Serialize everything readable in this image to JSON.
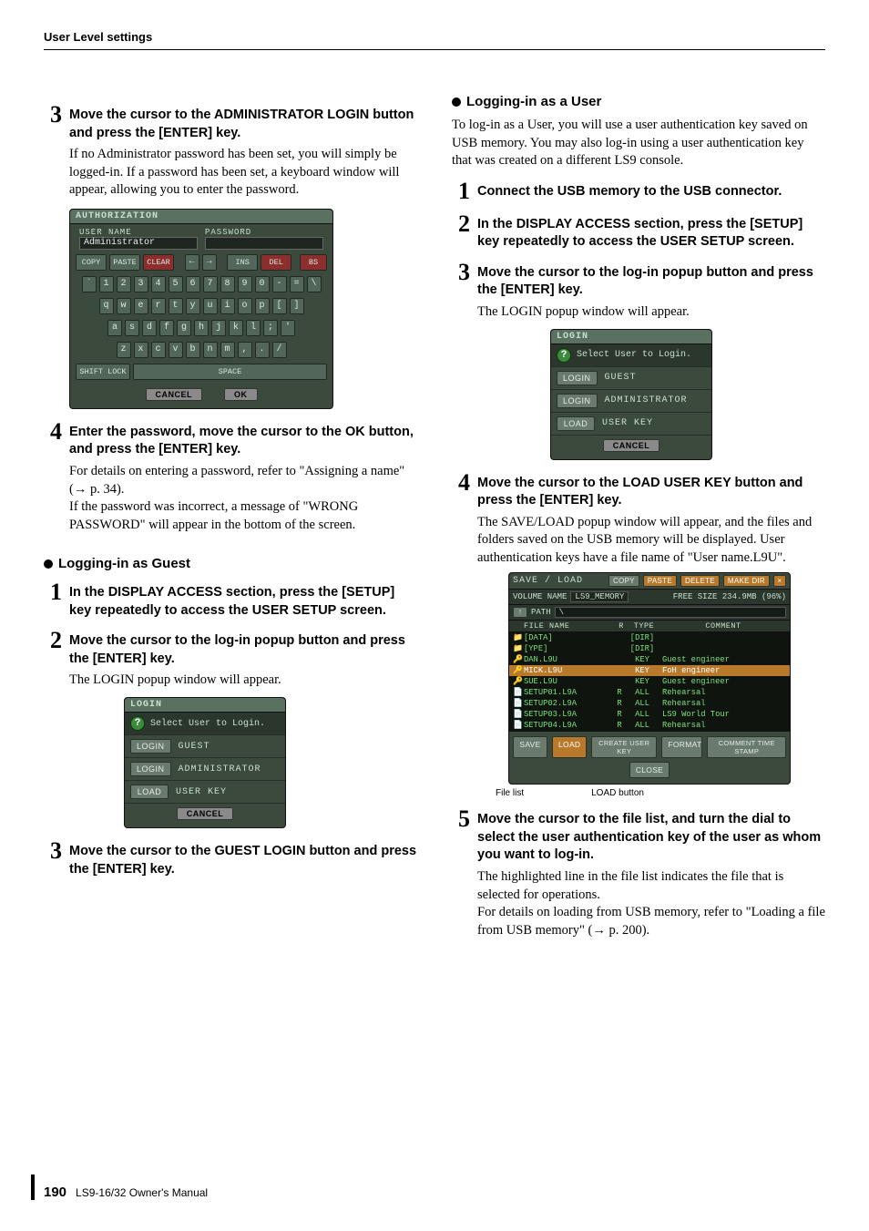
{
  "header": {
    "section": "User Level settings"
  },
  "left": {
    "step3": {
      "n": "3",
      "h": "Move the cursor to the ADMINISTRATOR LOGIN button and press the [ENTER] key.",
      "body": "If no Administrator password has been set, you will simply be logged-in. If a password has been set, a keyboard window will appear, allowing you to enter the password."
    },
    "auth": {
      "title": "AUTHORIZATION",
      "userNameLabel": "USER NAME",
      "userName": "Administrator",
      "passwordLabel": "PASSWORD",
      "password": "",
      "keysTop": {
        "copy": "COPY",
        "paste": "PASTE",
        "clear": "CLEAR",
        "left": "←",
        "right": "→",
        "ins": "INS",
        "del": "DEL",
        "bs": "BS"
      },
      "row1": [
        "`",
        "1",
        "2",
        "3",
        "4",
        "5",
        "6",
        "7",
        "8",
        "9",
        "0",
        "-",
        "=",
        "\\"
      ],
      "row2": [
        "q",
        "w",
        "e",
        "r",
        "t",
        "y",
        "u",
        "i",
        "o",
        "p",
        "[",
        "]"
      ],
      "row3": [
        "a",
        "s",
        "d",
        "f",
        "g",
        "h",
        "j",
        "k",
        "l",
        ";",
        "'"
      ],
      "row4": [
        "z",
        "x",
        "c",
        "v",
        "b",
        "n",
        "m",
        ",",
        ".",
        "/"
      ],
      "shiftlock": "SHIFT LOCK",
      "space": "SPACE",
      "cancel": "CANCEL",
      "ok": "OK"
    },
    "step4": {
      "n": "4",
      "h": "Enter the password, move the cursor to the OK button, and press the [ENTER] key.",
      "body1": "For details on entering a password, refer to \"Assigning a name\" (→ p. 34).",
      "body2": "If the password was incorrect, a message of \"WRONG PASSWORD\" will appear in the bottom of the screen."
    },
    "sub_guest": "Logging-in as Guest",
    "g1": {
      "n": "1",
      "h": "In the DISPLAY ACCESS section, press the [SETUP] key repeatedly to access the USER SETUP screen."
    },
    "g2": {
      "n": "2",
      "h": "Move the cursor to the log-in popup button and press the [ENTER] key.",
      "body": "The LOGIN popup window will appear."
    },
    "login": {
      "title": "LOGIN",
      "hint": "Select User to Login.",
      "rows": [
        {
          "btn": "LOGIN",
          "lab": "GUEST"
        },
        {
          "btn": "LOGIN",
          "lab": "ADMINISTRATOR"
        },
        {
          "btn": "LOAD",
          "lab": "USER KEY"
        }
      ],
      "cancel": "CANCEL"
    },
    "g3": {
      "n": "3",
      "h": "Move the cursor to the GUEST LOGIN button and press the [ENTER] key."
    }
  },
  "right": {
    "sub_user": "Logging-in as a User",
    "intro": "To log-in as a User, you will use a user authentication key saved on USB memory. You may also log-in using a user authentication key that was created on a different LS9 console.",
    "u1": {
      "n": "1",
      "h": "Connect the USB memory to the USB connector."
    },
    "u2": {
      "n": "2",
      "h": "In the DISPLAY ACCESS section, press the [SETUP] key repeatedly to access the USER SETUP screen."
    },
    "u3": {
      "n": "3",
      "h": "Move the cursor to the log-in popup button and press the [ENTER] key.",
      "body": "The LOGIN popup window will appear."
    },
    "u4": {
      "n": "4",
      "h": "Move the cursor to the LOAD USER KEY button and press the [ENTER] key.",
      "body": "The SAVE/LOAD popup window will appear, and the files and folders saved on the USB memory will be displayed. User authentication keys have a file name of \"User name.L9U\"."
    },
    "save": {
      "title": "SAVE / LOAD",
      "topbtns": {
        "copy": "COPY",
        "paste": "PASTE",
        "delete": "DELETE",
        "makedir": "MAKE DIR",
        "x": "×"
      },
      "volLabel": "VOLUME NAME",
      "volName": "LS9_MEMORY",
      "freeLabel": "FREE SIZE 234.9MB (96%)",
      "pathLabel": "PATH",
      "path": "\\",
      "cols": {
        "file": "FILE NAME",
        "rw": "R",
        "type": "TYPE",
        "comment": "COMMENT"
      },
      "rows": [
        {
          "ico": "📁",
          "name": "[DATA]",
          "rw": "",
          "type": "[DIR]",
          "comment": ""
        },
        {
          "ico": "📁",
          "name": "[YPE]",
          "rw": "",
          "type": "[DIR]",
          "comment": ""
        },
        {
          "ico": "🔑",
          "name": "DAN.L9U",
          "rw": "",
          "type": "KEY",
          "comment": "Guest engineer"
        },
        {
          "ico": "🔑",
          "name": "MICK.L9U",
          "rw": "",
          "type": "KEY",
          "comment": "FoH engineer",
          "sel": true
        },
        {
          "ico": "🔑",
          "name": "SUE.L9U",
          "rw": "",
          "type": "KEY",
          "comment": "Guest engineer"
        },
        {
          "ico": "📄",
          "name": "SETUP01.L9A",
          "rw": "R",
          "type": "ALL",
          "comment": "Rehearsal"
        },
        {
          "ico": "📄",
          "name": "SETUP02.L9A",
          "rw": "R",
          "type": "ALL",
          "comment": "Rehearsal"
        },
        {
          "ico": "📄",
          "name": "SETUP03.L9A",
          "rw": "R",
          "type": "ALL",
          "comment": "LS9 World Tour"
        },
        {
          "ico": "📄",
          "name": "SETUP04.L9A",
          "rw": "R",
          "type": "ALL",
          "comment": "Rehearsal"
        }
      ],
      "bot": {
        "save": "SAVE",
        "load": "LOAD",
        "create": "CREATE\nUSER KEY",
        "format": "FORMAT",
        "comment": "COMMENT\nTIME STAMP",
        "close": "CLOSE"
      },
      "labelFileList": "File list",
      "labelLoad": "LOAD button"
    },
    "u5": {
      "n": "5",
      "h": "Move the cursor to the file list, and turn the dial to select the user authentication key of the user as whom you want to log-in.",
      "body1": "The highlighted line in the file list indicates the file that is selected for operations.",
      "body2": "For details on loading from USB memory, refer to \"Loading a file from USB memory\" (→ p. 200)."
    }
  },
  "footer": {
    "page": "190",
    "book": "LS9-16/32  Owner's Manual"
  }
}
